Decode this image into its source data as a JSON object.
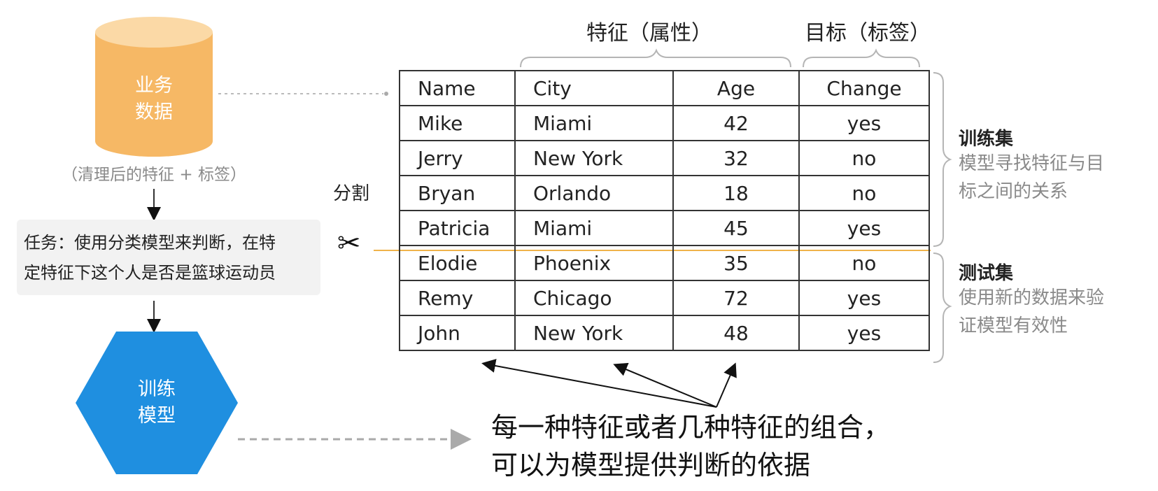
{
  "data_source": {
    "label_line1": "业务",
    "label_line2": "数据",
    "caption": "（清理后的特征 + 标签）"
  },
  "task": {
    "line1": "任务：使用分类模型来判断，在特",
    "line2": "定特征下这个人是否是篮球运动员"
  },
  "model": {
    "label_line1": "训练",
    "label_line2": "模型"
  },
  "headings": {
    "features": "特征（属性）",
    "target": "目标（标签）"
  },
  "split_label": "分割",
  "table": {
    "columns": [
      "Name",
      "City",
      "Age",
      "Change"
    ],
    "rows": [
      [
        "Mike",
        "Miami",
        "42",
        "yes"
      ],
      [
        "Jerry",
        "New York",
        "32",
        "no"
      ],
      [
        "Bryan",
        "Orlando",
        "18",
        "no"
      ],
      [
        "Patricia",
        "Miami",
        "45",
        "yes"
      ],
      [
        "Elodie",
        "Phoenix",
        "35",
        "no"
      ],
      [
        "Remy",
        "Chicago",
        "72",
        "yes"
      ],
      [
        "John",
        "New York",
        "48",
        "yes"
      ]
    ]
  },
  "training_set": {
    "title": "训练集",
    "desc_line1": "模型寻找特征与目",
    "desc_line2": "标之间的关系"
  },
  "test_set": {
    "title": "测试集",
    "desc_line1": "使用新的数据来验",
    "desc_line2": "证模型有效性"
  },
  "caption": {
    "line1": "每一种特征或者几种特征的组合，",
    "line2": "可以为模型提供判断的依据"
  },
  "colors": {
    "cylinder": "#f6b865",
    "cylinder_top": "#fbd9a6",
    "hexagon": "#1f8fe0",
    "split_line": "#f0b34a",
    "bracket": "#b5b5b5"
  }
}
